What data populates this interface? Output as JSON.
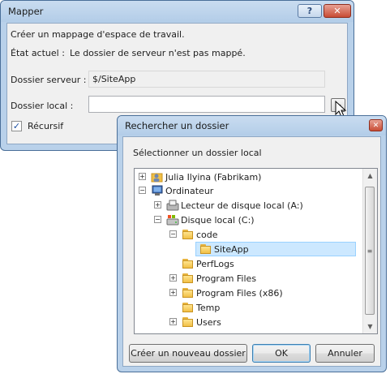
{
  "mapper": {
    "title": "Mapper",
    "help_label": "?",
    "close_label": "✕",
    "intro": "Créer un mappage d'espace de travail.",
    "status_label": "État actuel :",
    "status_value": "Le dossier de serveur n'est pas mappé.",
    "server_folder_label": "Dossier serveur :",
    "server_folder_value": "$/SiteApp",
    "local_folder_label": "Dossier local :",
    "local_folder_value": "",
    "browse_label": "...",
    "recursive_label": "Récursif",
    "recursive_checked": true
  },
  "dialog": {
    "title": "Rechercher un dossier",
    "close_label": "✕",
    "prompt": "Sélectionner un dossier local",
    "tree": [
      {
        "label": "Julia Ilyina (Fabrikam)",
        "icon": "user-folder-icon",
        "expander": "+"
      },
      {
        "label": "Ordinateur",
        "icon": "computer-icon",
        "expander": "−"
      },
      {
        "label": "Lecteur de disque local (A:)",
        "icon": "floppy-drive-icon",
        "expander": "+"
      },
      {
        "label": "Disque local (C:)",
        "icon": "hard-drive-icon",
        "expander": "−"
      },
      {
        "label": "code",
        "icon": "folder-open-icon",
        "expander": "−"
      },
      {
        "label": "SiteApp",
        "icon": "folder-icon",
        "expander": "",
        "selected": true
      },
      {
        "label": "PerfLogs",
        "icon": "folder-icon",
        "expander": ""
      },
      {
        "label": "Program Files",
        "icon": "folder-icon",
        "expander": "+"
      },
      {
        "label": "Program Files (x86)",
        "icon": "folder-icon",
        "expander": "+"
      },
      {
        "label": "Temp",
        "icon": "folder-icon",
        "expander": ""
      },
      {
        "label": "Users",
        "icon": "folder-icon",
        "expander": "+"
      }
    ],
    "new_folder_label": "Créer un nouveau dossier",
    "ok_label": "OK",
    "cancel_label": "Annuler"
  }
}
